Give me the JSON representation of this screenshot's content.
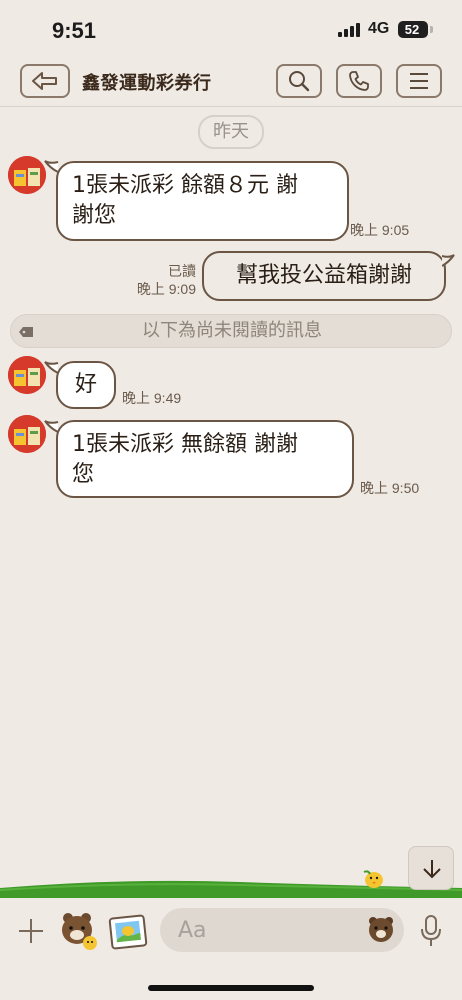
{
  "status_bar": {
    "time": "9:51",
    "network": "4G",
    "battery": "52"
  },
  "header": {
    "title": "鑫發運動彩券行"
  },
  "date_chip": "昨天",
  "messages": [
    {
      "sender": "other",
      "text": "1張未派彩 餘額８元 謝\n謝您",
      "time": "晚上 9:05"
    },
    {
      "sender": "me",
      "text": "幫我投公益箱謝謝",
      "read_label": "已讀",
      "time": "晚上 9:09"
    },
    {
      "sender": "other",
      "text": "好",
      "time": "晚上 9:49"
    },
    {
      "sender": "other",
      "text": "1張未派彩 無餘額 謝謝\n您",
      "time": "晚上 9:50"
    }
  ],
  "unread_divider": "以下為尚未閱讀的訊息",
  "input": {
    "placeholder": "Aa"
  },
  "colors": {
    "background": "#efeae4",
    "bubble_border": "#6b5544",
    "grass": "#3f9a2a"
  }
}
